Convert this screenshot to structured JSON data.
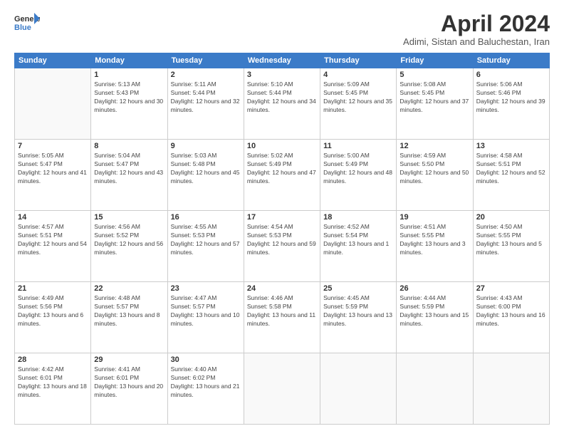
{
  "header": {
    "logo_line1": "General",
    "logo_line2": "Blue",
    "title": "April 2024",
    "subtitle": "Adimi, Sistan and Baluchestan, Iran"
  },
  "weekdays": [
    "Sunday",
    "Monday",
    "Tuesday",
    "Wednesday",
    "Thursday",
    "Friday",
    "Saturday"
  ],
  "weeks": [
    [
      {
        "day": "",
        "empty": true
      },
      {
        "day": "1",
        "sunrise": "5:13 AM",
        "sunset": "5:43 PM",
        "daylight": "12 hours and 30 minutes."
      },
      {
        "day": "2",
        "sunrise": "5:11 AM",
        "sunset": "5:44 PM",
        "daylight": "12 hours and 32 minutes."
      },
      {
        "day": "3",
        "sunrise": "5:10 AM",
        "sunset": "5:44 PM",
        "daylight": "12 hours and 34 minutes."
      },
      {
        "day": "4",
        "sunrise": "5:09 AM",
        "sunset": "5:45 PM",
        "daylight": "12 hours and 35 minutes."
      },
      {
        "day": "5",
        "sunrise": "5:08 AM",
        "sunset": "5:45 PM",
        "daylight": "12 hours and 37 minutes."
      },
      {
        "day": "6",
        "sunrise": "5:06 AM",
        "sunset": "5:46 PM",
        "daylight": "12 hours and 39 minutes."
      }
    ],
    [
      {
        "day": "7",
        "sunrise": "5:05 AM",
        "sunset": "5:47 PM",
        "daylight": "12 hours and 41 minutes."
      },
      {
        "day": "8",
        "sunrise": "5:04 AM",
        "sunset": "5:47 PM",
        "daylight": "12 hours and 43 minutes."
      },
      {
        "day": "9",
        "sunrise": "5:03 AM",
        "sunset": "5:48 PM",
        "daylight": "12 hours and 45 minutes."
      },
      {
        "day": "10",
        "sunrise": "5:02 AM",
        "sunset": "5:49 PM",
        "daylight": "12 hours and 47 minutes."
      },
      {
        "day": "11",
        "sunrise": "5:00 AM",
        "sunset": "5:49 PM",
        "daylight": "12 hours and 48 minutes."
      },
      {
        "day": "12",
        "sunrise": "4:59 AM",
        "sunset": "5:50 PM",
        "daylight": "12 hours and 50 minutes."
      },
      {
        "day": "13",
        "sunrise": "4:58 AM",
        "sunset": "5:51 PM",
        "daylight": "12 hours and 52 minutes."
      }
    ],
    [
      {
        "day": "14",
        "sunrise": "4:57 AM",
        "sunset": "5:51 PM",
        "daylight": "12 hours and 54 minutes."
      },
      {
        "day": "15",
        "sunrise": "4:56 AM",
        "sunset": "5:52 PM",
        "daylight": "12 hours and 56 minutes."
      },
      {
        "day": "16",
        "sunrise": "4:55 AM",
        "sunset": "5:53 PM",
        "daylight": "12 hours and 57 minutes."
      },
      {
        "day": "17",
        "sunrise": "4:54 AM",
        "sunset": "5:53 PM",
        "daylight": "12 hours and 59 minutes."
      },
      {
        "day": "18",
        "sunrise": "4:52 AM",
        "sunset": "5:54 PM",
        "daylight": "13 hours and 1 minute."
      },
      {
        "day": "19",
        "sunrise": "4:51 AM",
        "sunset": "5:55 PM",
        "daylight": "13 hours and 3 minutes."
      },
      {
        "day": "20",
        "sunrise": "4:50 AM",
        "sunset": "5:55 PM",
        "daylight": "13 hours and 5 minutes."
      }
    ],
    [
      {
        "day": "21",
        "sunrise": "4:49 AM",
        "sunset": "5:56 PM",
        "daylight": "13 hours and 6 minutes."
      },
      {
        "day": "22",
        "sunrise": "4:48 AM",
        "sunset": "5:57 PM",
        "daylight": "13 hours and 8 minutes."
      },
      {
        "day": "23",
        "sunrise": "4:47 AM",
        "sunset": "5:57 PM",
        "daylight": "13 hours and 10 minutes."
      },
      {
        "day": "24",
        "sunrise": "4:46 AM",
        "sunset": "5:58 PM",
        "daylight": "13 hours and 11 minutes."
      },
      {
        "day": "25",
        "sunrise": "4:45 AM",
        "sunset": "5:59 PM",
        "daylight": "13 hours and 13 minutes."
      },
      {
        "day": "26",
        "sunrise": "4:44 AM",
        "sunset": "5:59 PM",
        "daylight": "13 hours and 15 minutes."
      },
      {
        "day": "27",
        "sunrise": "4:43 AM",
        "sunset": "6:00 PM",
        "daylight": "13 hours and 16 minutes."
      }
    ],
    [
      {
        "day": "28",
        "sunrise": "4:42 AM",
        "sunset": "6:01 PM",
        "daylight": "13 hours and 18 minutes."
      },
      {
        "day": "29",
        "sunrise": "4:41 AM",
        "sunset": "6:01 PM",
        "daylight": "13 hours and 20 minutes."
      },
      {
        "day": "30",
        "sunrise": "4:40 AM",
        "sunset": "6:02 PM",
        "daylight": "13 hours and 21 minutes."
      },
      {
        "day": "",
        "empty": true
      },
      {
        "day": "",
        "empty": true
      },
      {
        "day": "",
        "empty": true
      },
      {
        "day": "",
        "empty": true
      }
    ]
  ]
}
